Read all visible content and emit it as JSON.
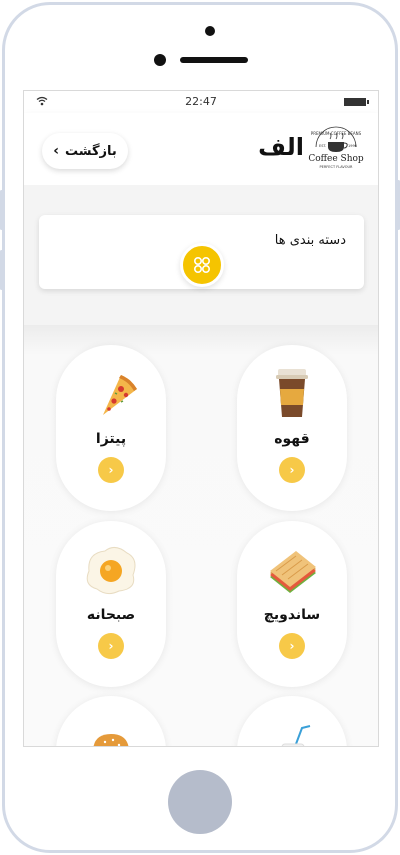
{
  "status_bar": {
    "time": "22:47"
  },
  "header": {
    "title": "الف",
    "back_label": "بازگشت",
    "logo_text": "Coffee Shop",
    "logo_tagline": "PREMIUM COFFEE BEANS",
    "logo_sub": "PERFECT FLAVOUR",
    "logo_est": "EST.",
    "logo_year": "1996"
  },
  "categories": {
    "title": "دسته بندی ها"
  },
  "items": [
    {
      "label": "پیتزا",
      "icon": "pizza-icon"
    },
    {
      "label": "قهوه",
      "icon": "coffee-cup-icon"
    },
    {
      "label": "صبحانه",
      "icon": "fried-egg-icon"
    },
    {
      "label": "ساندویچ",
      "icon": "sandwich-icon"
    },
    {
      "label": "",
      "icon": "burger-icon"
    },
    {
      "label": "",
      "icon": "drink-icon"
    }
  ],
  "colors": {
    "accent": "#f5c400",
    "arrow": "#f7c948",
    "frame": "#d2d9e6"
  }
}
